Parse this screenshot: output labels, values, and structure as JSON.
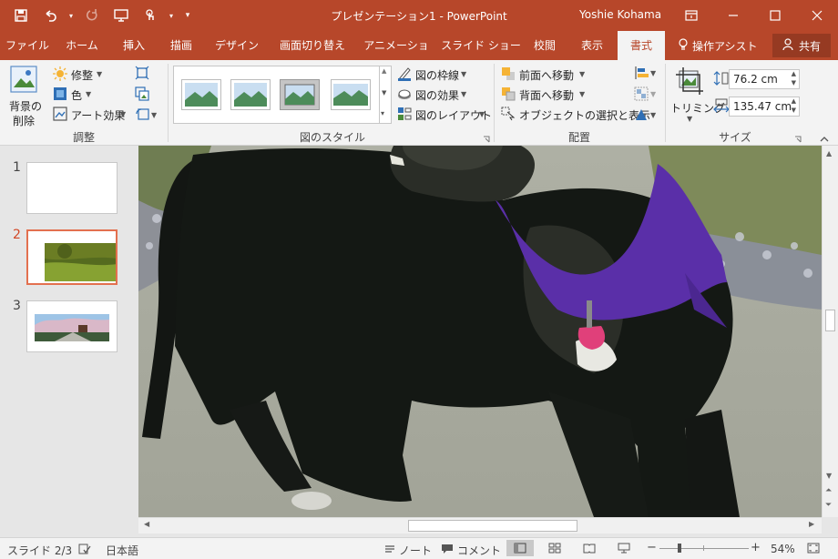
{
  "titlebar": {
    "title": "プレゼンテーション1 - PowerPoint",
    "user": "Yoshie Kohama"
  },
  "tabs": [
    {
      "label": "ファイル",
      "active": false
    },
    {
      "label": "ホーム",
      "active": false
    },
    {
      "label": "挿入",
      "active": false
    },
    {
      "label": "描画",
      "active": false
    },
    {
      "label": "デザイン",
      "active": false
    },
    {
      "label": "画面切り替え",
      "active": false
    },
    {
      "label": "アニメーション",
      "active": false
    },
    {
      "label": "スライド ショー",
      "active": false
    },
    {
      "label": "校閲",
      "active": false
    },
    {
      "label": "表示",
      "active": false
    },
    {
      "label": "書式",
      "active": true
    }
  ],
  "tell_me": "操作アシスト",
  "share": "共有",
  "ribbon": {
    "adjust": {
      "remove_bg_line1": "背景の",
      "remove_bg_line2": "削除",
      "corrections": "修整",
      "color": "色",
      "artistic": "アート効果",
      "group": "調整"
    },
    "styles": {
      "border": "図の枠線",
      "effects": "図の効果",
      "layout": "図のレイアウト",
      "group": "図のスタイル"
    },
    "arrange": {
      "bring_forward": "前面へ移動",
      "send_backward": "背面へ移動",
      "selection_pane": "オブジェクトの選択と表示",
      "group": "配置"
    },
    "size": {
      "crop": "トリミング",
      "height": "76.2 cm",
      "width": "135.47 cm",
      "group": "サイズ"
    }
  },
  "slides": [
    {
      "number": "1",
      "selected": false
    },
    {
      "number": "2",
      "selected": true
    },
    {
      "number": "3",
      "selected": false
    }
  ],
  "status": {
    "slide": "スライド 2/3",
    "language": "日本語",
    "notes": "ノート",
    "comments": "コメント",
    "zoom": "54%"
  },
  "colors": {
    "accent": "#b7472a",
    "bandana": "#5a2fa8",
    "tag": "#e0407a"
  }
}
